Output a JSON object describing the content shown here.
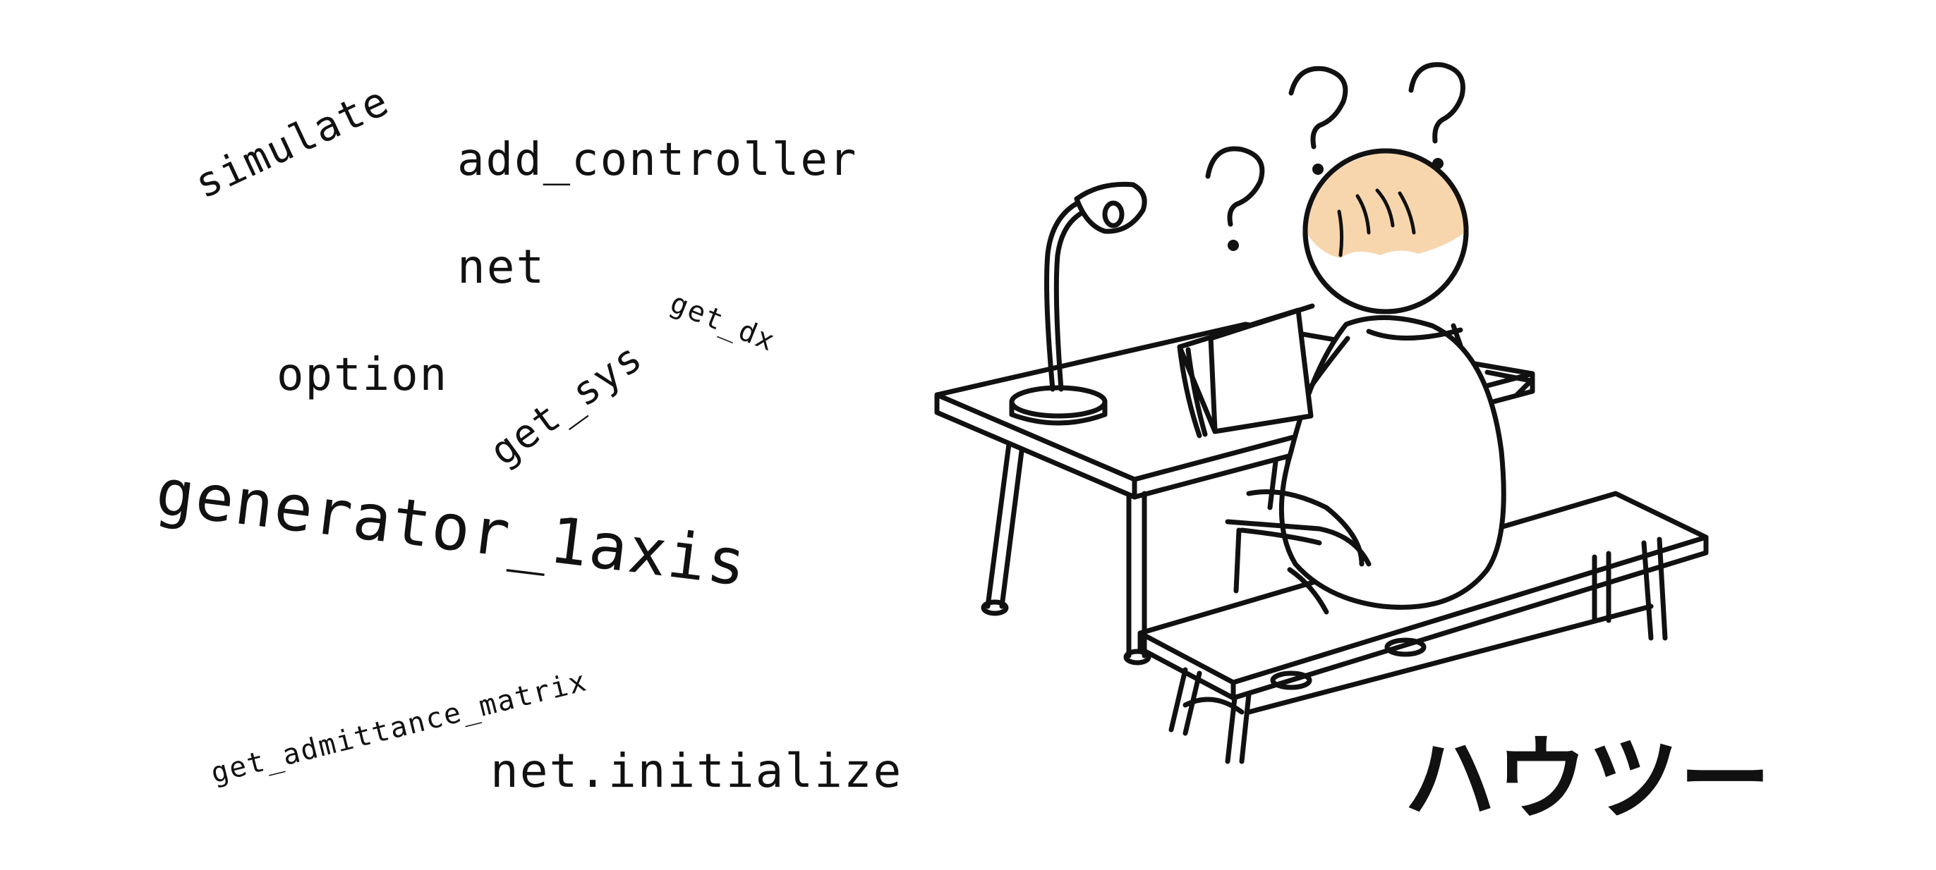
{
  "words": {
    "simulate": "simulate",
    "add_controller": "add_controller",
    "net": "net",
    "get_dx": "get_dx",
    "option": "option",
    "get_sys": "get_sys",
    "generator_1axis": "generator_1axis",
    "get_admittance_matrix": "get_admittance_matrix",
    "net_initialize": "net.initialize"
  },
  "title": "ハウツー",
  "colors": {
    "ink": "#111111",
    "hair": "#f8d6ad",
    "background": "#ffffff"
  }
}
